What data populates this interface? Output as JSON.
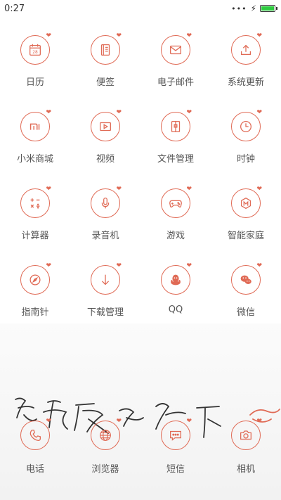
{
  "status": {
    "time": "0:27",
    "signal": "•••",
    "charging": "⚡"
  },
  "colors": {
    "accent": "#e06a55"
  },
  "apps": [
    {
      "label": "日历",
      "icon": "calendar-icon",
      "badge": "28"
    },
    {
      "label": "便签",
      "icon": "notes-icon"
    },
    {
      "label": "电子邮件",
      "icon": "mail-icon"
    },
    {
      "label": "系统更新",
      "icon": "system-update-icon"
    },
    {
      "label": "小米商城",
      "icon": "mi-store-icon",
      "badge": "mi"
    },
    {
      "label": "视频",
      "icon": "video-icon"
    },
    {
      "label": "文件管理",
      "icon": "file-manager-icon"
    },
    {
      "label": "时钟",
      "icon": "clock-icon"
    },
    {
      "label": "计算器",
      "icon": "calculator-icon"
    },
    {
      "label": "录音机",
      "icon": "recorder-icon"
    },
    {
      "label": "游戏",
      "icon": "game-icon"
    },
    {
      "label": "智能家庭",
      "icon": "smart-home-icon"
    },
    {
      "label": "指南针",
      "icon": "compass-icon"
    },
    {
      "label": "下载管理",
      "icon": "download-icon"
    },
    {
      "label": "QQ",
      "icon": "qq-icon"
    },
    {
      "label": "微信",
      "icon": "wechat-icon"
    }
  ],
  "dock": [
    {
      "label": "电话",
      "icon": "phone-icon"
    },
    {
      "label": "浏览器",
      "icon": "browser-icon"
    },
    {
      "label": "短信",
      "icon": "sms-icon"
    },
    {
      "label": "相机",
      "icon": "camera-icon"
    }
  ]
}
